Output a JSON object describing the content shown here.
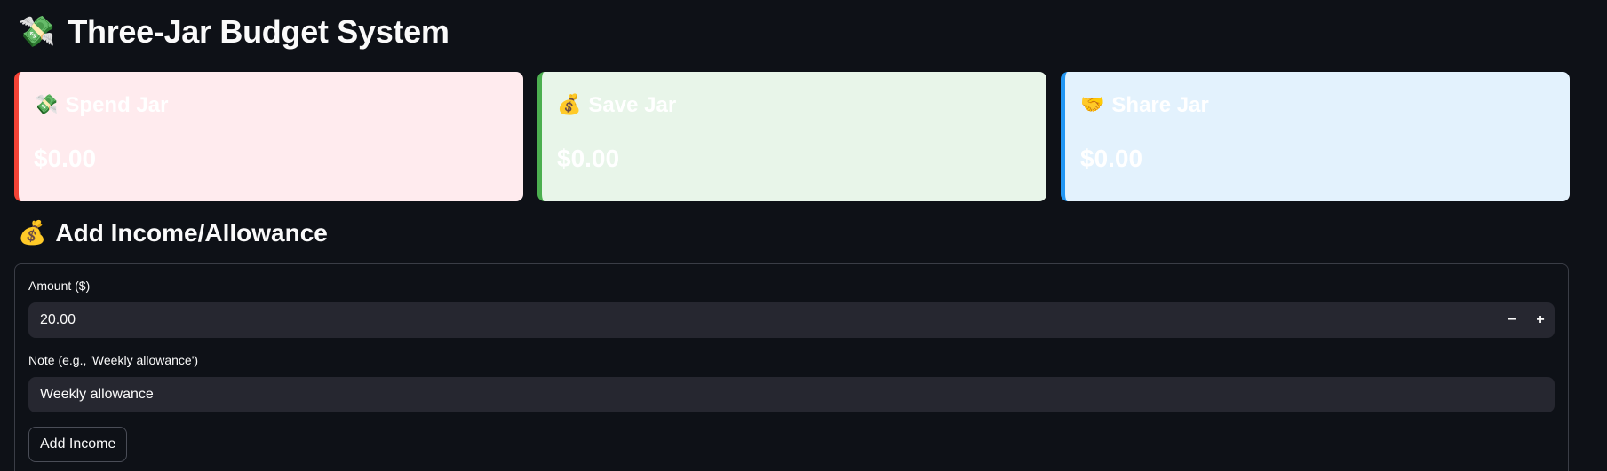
{
  "app": {
    "title": "Three-Jar Budget System",
    "title_icon": "💸"
  },
  "jars": [
    {
      "icon": "💸",
      "title": "Spend Jar",
      "amount": "$0.00",
      "bg_color": "#ffebee",
      "accent_color": "#f44336"
    },
    {
      "icon": "💰",
      "title": "Save Jar",
      "amount": "$0.00",
      "bg_color": "#e8f5e9",
      "accent_color": "#4caf50"
    },
    {
      "icon": "🤝",
      "title": "Share Jar",
      "amount": "$0.00",
      "bg_color": "#e3f2fd",
      "accent_color": "#2196f3"
    }
  ],
  "income_section": {
    "icon": "💰",
    "title": "Add Income/Allowance",
    "amount_label": "Amount ($)",
    "amount_value": "20.00",
    "decrement_label": "−",
    "increment_label": "+",
    "note_label": "Note (e.g., 'Weekly allowance')",
    "note_value": "Weekly allowance",
    "submit_label": "Add Income"
  },
  "theme": {
    "background": "#0e1117",
    "input_background": "#262730",
    "text": "#fafafa"
  }
}
